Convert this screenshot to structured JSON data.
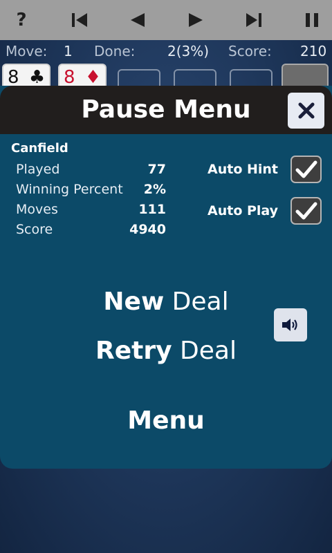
{
  "toolbar": {
    "help_label": "?"
  },
  "stats": {
    "move_label": "Move:",
    "move_value": "1",
    "done_label": "Done:",
    "done_value": "2(3%)",
    "score_label": "Score:",
    "score_value": "210"
  },
  "cards": [
    {
      "rank": "8",
      "suit": "♣",
      "color": "#111111"
    },
    {
      "rank": "8",
      "suit": "♦",
      "color": "#c8102e"
    }
  ],
  "dialog": {
    "title": "Pause Menu",
    "game_name": "Canfield",
    "stats": [
      {
        "label": "Played",
        "value": "77"
      },
      {
        "label": "Winning Percent",
        "value": "2%"
      },
      {
        "label": "Moves",
        "value": "111"
      },
      {
        "label": "Score",
        "value": "4940"
      }
    ],
    "options": [
      {
        "label": "Auto Hint",
        "checked": true
      },
      {
        "label": "Auto Play",
        "checked": true
      }
    ],
    "new_deal": {
      "bold": "New",
      "rest": " Deal"
    },
    "retry_deal": {
      "bold": "Retry",
      "rest": " Deal"
    },
    "menu_label": "Menu"
  },
  "colors": {
    "toolbar_bg": "#9e9e9e",
    "dialog_bg": "#0c4a68",
    "header_bg": "#211e1d",
    "table_bg": "#1d3558"
  }
}
